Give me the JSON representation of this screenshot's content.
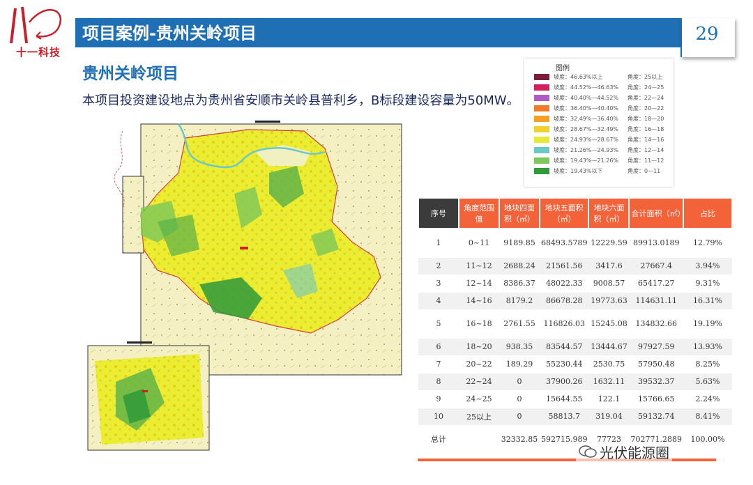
{
  "logo": {
    "text": "十一科技"
  },
  "header": {
    "title": "项目案例-贵州关岭项目",
    "page_number": "29"
  },
  "content": {
    "subtitle": "贵州关岭项目",
    "description": "本项目投资建设地点为贵州省安顺市关岭县普利乡，B标段建设容量为50MW。"
  },
  "legend": {
    "title": "图例",
    "items": [
      {
        "label": "坡度：46.63%以上",
        "angle": "角度：25以上",
        "color": "#7a1e3a"
      },
      {
        "label": "坡度：44.52%—46.63%",
        "angle": "角度：24—25",
        "color": "#d2205a"
      },
      {
        "label": "坡度：40.40%—44.52%",
        "angle": "角度：22—24",
        "color": "#b05ac8"
      },
      {
        "label": "坡度：36.40%—40.40%",
        "angle": "角度：20—22",
        "color": "#f07a2a"
      },
      {
        "label": "坡度：32.49%—36.40%",
        "angle": "角度：18—20",
        "color": "#f4a020"
      },
      {
        "label": "坡度：28.67%—32.49%",
        "angle": "角度：16—18",
        "color": "#f2d22a"
      },
      {
        "label": "坡度：24.93%—28.67%",
        "angle": "角度：14—16",
        "color": "#e8e83a"
      },
      {
        "label": "坡度：21.26%—24.93%",
        "angle": "角度：12—14",
        "color": "#6cc8c8"
      },
      {
        "label": "坡度：19.43%—21.26%",
        "angle": "角度：11—12",
        "color": "#7cc85a"
      },
      {
        "label": "坡度：19.43%以下",
        "angle": "角度：0—11",
        "color": "#2e9a3a"
      }
    ]
  },
  "table": {
    "headers": [
      "序号",
      "角度范围值",
      "地块四面积（㎡）",
      "地块五面积（㎡）",
      "地块六面积（㎡）",
      "合计面积（㎡）",
      "占比"
    ],
    "rows": [
      [
        "1",
        "0~11",
        "9189.85",
        "68493.5789",
        "12229.59",
        "89913.0189",
        "12.79%"
      ],
      [
        "2",
        "11~12",
        "2688.24",
        "21561.56",
        "3417.6",
        "27667.4",
        "3.94%"
      ],
      [
        "3",
        "12~14",
        "8386.37",
        "48022.33",
        "9008.57",
        "65417.27",
        "9.31%"
      ],
      [
        "4",
        "14~16",
        "8179.2",
        "86678.28",
        "19773.63",
        "114631.11",
        "16.31%"
      ],
      [
        "5",
        "16~18",
        "2761.55",
        "116826.03",
        "15245.08",
        "134832.66",
        "19.19%"
      ],
      [
        "6",
        "18~20",
        "938.35",
        "83544.57",
        "13444.67",
        "97927.59",
        "13.93%"
      ],
      [
        "7",
        "20~22",
        "189.29",
        "55230.44",
        "2530.75",
        "57950.48",
        "8.25%"
      ],
      [
        "8",
        "22~24",
        "0",
        "37900.26",
        "1632.11",
        "39532.37",
        "5.63%"
      ],
      [
        "9",
        "24~25",
        "0",
        "15644.55",
        "122.1",
        "15766.65",
        "2.24%"
      ],
      [
        "10",
        "25以上",
        "0",
        "58813.7",
        "319.04",
        "59132.74",
        "8.41%"
      ],
      [
        "总计",
        "",
        "32332.85",
        "592715.989",
        "77723",
        "702771.2889",
        "100.00%"
      ]
    ]
  },
  "watermark": {
    "text": "光伏能源圈"
  },
  "colors": {
    "brand_blue": "#1f6fb5",
    "table_orange": "#f4623a",
    "table_dark": "#3b3b3b",
    "logo_red": "#c8202a"
  }
}
